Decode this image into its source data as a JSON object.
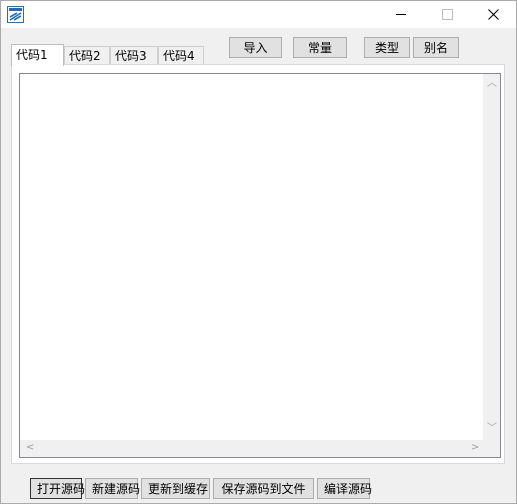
{
  "window": {
    "title": "",
    "icon": "app-document-icon",
    "controls": {
      "minimize": "─",
      "maximize": "☐",
      "close": "✕"
    }
  },
  "tabs": [
    {
      "label": "代码1",
      "active": true
    },
    {
      "label": "代码2",
      "active": false
    },
    {
      "label": "代码3",
      "active": false
    },
    {
      "label": "代码4",
      "active": false
    }
  ],
  "toolbar": {
    "import_label": "导入",
    "constant_label": "常量",
    "type_label": "类型",
    "alias_label": "别名"
  },
  "editor": {
    "content": "",
    "scroll_up": "︿",
    "scroll_down": "﹀",
    "scroll_left": "<",
    "scroll_right": ">"
  },
  "bottom_bar": {
    "open_source_label": "打开源码",
    "new_source_label": "新建源码",
    "update_cache_label": "更新到缓存",
    "save_file_label": "保存源码到文件",
    "compile_label": "编译源码"
  },
  "colors": {
    "button_face": "#e1e1e1",
    "window_bg": "#f0f0f0",
    "editor_bg": "#ffffff",
    "icon_accent": "#1e6fb7"
  }
}
